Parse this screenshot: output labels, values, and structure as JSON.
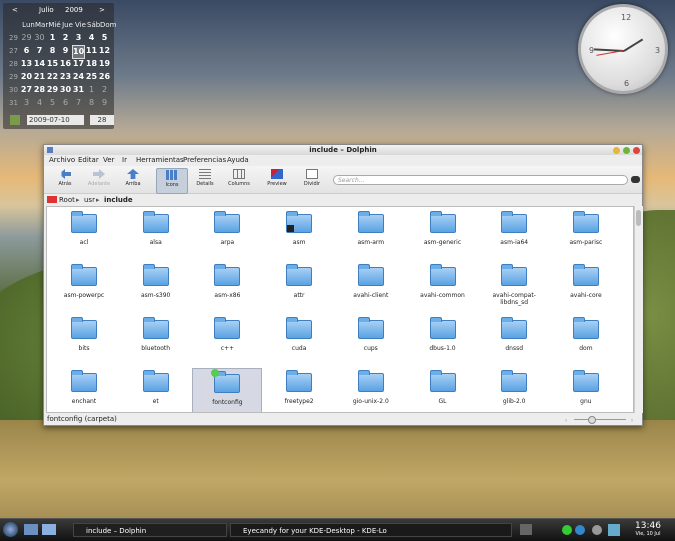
{
  "calendar": {
    "month": "Julio",
    "year": "2009",
    "prev": "<",
    "next": ">",
    "weekdays": [
      "Lun",
      "Mar",
      "Mié",
      "Jue",
      "Vie",
      "Sáb",
      "Dom"
    ],
    "weeks": [
      [
        "29",
        "29",
        "30",
        "1",
        "2",
        "3",
        "4",
        "5"
      ],
      [
        "27",
        "6",
        "7",
        "8",
        "9",
        "10",
        "11",
        "12"
      ],
      [
        "28",
        "13",
        "14",
        "15",
        "16",
        "17",
        "18",
        "19"
      ],
      [
        "29",
        "20",
        "21",
        "22",
        "23",
        "24",
        "25",
        "26"
      ],
      [
        "30",
        "27",
        "28",
        "29",
        "30",
        "31",
        "1",
        "2"
      ],
      [
        "31",
        "3",
        "4",
        "5",
        "6",
        "7",
        "8",
        "9"
      ]
    ],
    "date_value": "2009-07-10",
    "week_value": "28"
  },
  "clock": {
    "n12": "12",
    "n3": "3",
    "n6": "6",
    "n9": "9"
  },
  "window": {
    "title": "include – Dolphin",
    "menu": [
      "Archivo",
      "Editar",
      "Ver",
      "Ir",
      "Herramientas",
      "Preferencias",
      "Ayuda"
    ],
    "toolbar": {
      "back": "Atrás",
      "forward": "Adelante",
      "up": "Arriba",
      "icons": "Icons",
      "details": "Details",
      "columns": "Columns",
      "preview": "Preview",
      "split": "Dividir"
    },
    "search_placeholder": "Search...",
    "breadcrumb": [
      "Root",
      "usr",
      "include"
    ],
    "folders": [
      "acl",
      "alsa",
      "arpa",
      "asm",
      "asm-arm",
      "asm-generic",
      "asm-ia64",
      "asm-parisc",
      "asm-powerpc",
      "asm-s390",
      "asm-x86",
      "attr",
      "avahi-client",
      "avahi-common",
      "avahi-compat-libdns_sd",
      "avahi-core",
      "bits",
      "bluetooth",
      "c++",
      "cuda",
      "cups",
      "dbus-1.0",
      "dnssd",
      "dom",
      "enchant",
      "et",
      "fontconfig",
      "freetype2",
      "gio-unix-2.0",
      "GL",
      "glib-2.0",
      "gnu"
    ],
    "status": "fontconfig (carpeta)"
  },
  "taskbar": {
    "task1": "include – Dolphin",
    "task2": "Eyecandy for your KDE-Desktop - KDE-Lo",
    "time": "13:46",
    "date": "Vie, 10 Jul"
  },
  "colors": {
    "accent": "#5aa2e3",
    "selection": "#d6d9e3"
  }
}
